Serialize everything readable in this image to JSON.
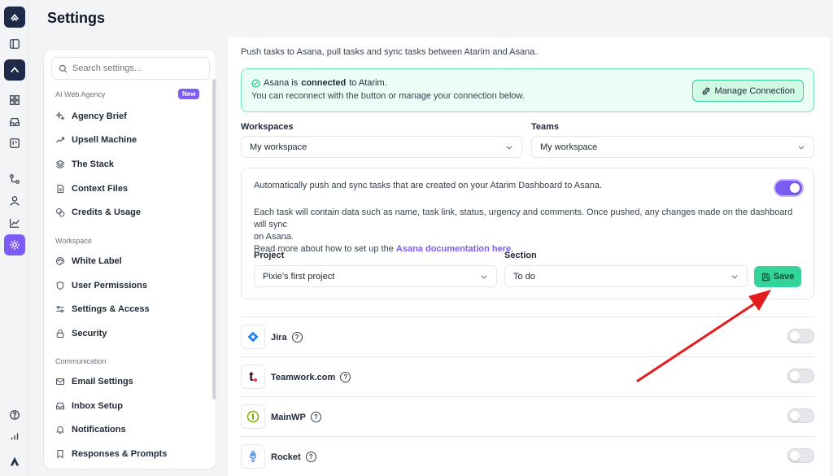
{
  "page_title": "Settings",
  "search": {
    "placeholder": "Search settings..."
  },
  "nav": {
    "sections": [
      {
        "label": "AI Web Agency",
        "badge": "New"
      },
      {
        "label": "Workspace"
      },
      {
        "label": "Communication"
      }
    ],
    "items": [
      {
        "label": "Agency Brief",
        "icon": "sparkles-icon"
      },
      {
        "label": "Upsell Machine",
        "icon": "trending-up-icon"
      },
      {
        "label": "The Stack",
        "icon": "layers-icon"
      },
      {
        "label": "Context Files",
        "icon": "file-icon"
      },
      {
        "label": "Credits & Usage",
        "icon": "coins-icon"
      },
      {
        "label": "White Label",
        "icon": "palette-icon"
      },
      {
        "label": "User Permissions",
        "icon": "shield-icon"
      },
      {
        "label": "Settings & Access",
        "icon": "sliders-icon"
      },
      {
        "label": "Security",
        "icon": "lock-icon"
      },
      {
        "label": "Email Settings",
        "icon": "mail-icon"
      },
      {
        "label": "Inbox Setup",
        "icon": "inbox-icon"
      },
      {
        "label": "Notifications",
        "icon": "bell-icon"
      },
      {
        "label": "Responses & Prompts",
        "icon": "bookmark-icon"
      }
    ]
  },
  "main": {
    "intro": "Push tasks to Asana, pull tasks and sync tasks between Atarim and Asana.",
    "connection": {
      "prefix": "Asana is",
      "status": "connected",
      "suffix": "to Atarim.",
      "hint": "You can reconnect with the button or manage your connection below.",
      "manage_label": "Manage Connection"
    },
    "workspaces": {
      "label": "Workspaces",
      "value": "My workspace"
    },
    "teams": {
      "label": "Teams",
      "value": "My workspace"
    },
    "sync": {
      "auto_text": "Automatically push and sync tasks that are created on your Atarim Dashboard to Asana.",
      "auto_enabled": true,
      "detail_line1": "Each task will contain data such as name, task link, status, urgency and comments. Once pushed, any changes made on the dashboard will sync",
      "detail_line2": "on Asana.",
      "docs_prefix": "Read more about how to set up the",
      "docs_link": "Asana documentation here",
      "docs_suffix": ".",
      "project": {
        "label": "Project",
        "value": "Pixie's first project"
      },
      "section": {
        "label": "Section",
        "value": "To do"
      },
      "save_label": "Save"
    },
    "integrations": [
      {
        "name": "Jira",
        "enabled": false
      },
      {
        "name": "Teamwork.com",
        "enabled": false
      },
      {
        "name": "MainWP",
        "enabled": false
      },
      {
        "name": "Rocket",
        "enabled": false
      }
    ]
  },
  "colors": {
    "accent": "#7c5cf5",
    "success": "#34d399",
    "brand_dark": "#1e2a4a",
    "annotation_arrow": "#e11d1d"
  }
}
